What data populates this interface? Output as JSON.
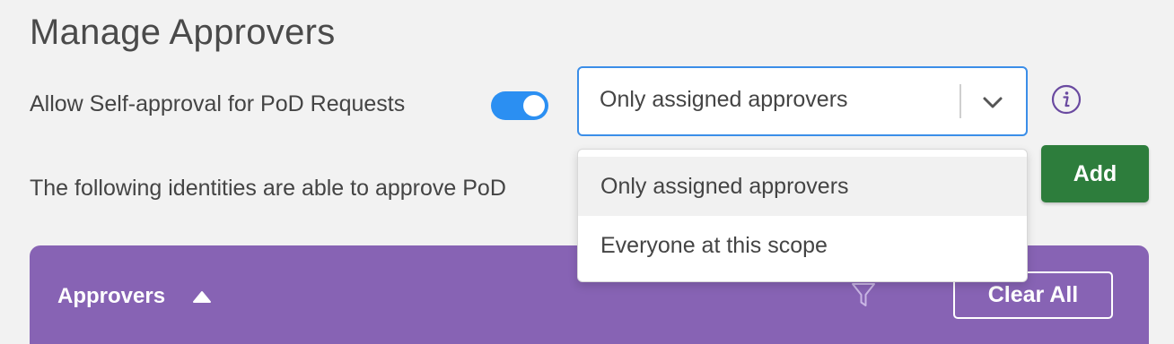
{
  "page": {
    "title": "Manage Approvers"
  },
  "self_approval": {
    "label": "Allow Self-approval for PoD Requests",
    "enabled": true,
    "select_value": "Only assigned approvers",
    "options": [
      "Only assigned approvers",
      "Everyone at this scope"
    ],
    "selected_option": "Only assigned approvers"
  },
  "identities": {
    "description": "The following identities are able to approve PoD"
  },
  "actions": {
    "add_label": "Add"
  },
  "approvers_panel": {
    "title": "Approvers",
    "clear_all_label": "Clear All"
  },
  "colors": {
    "toggle_on": "#2b8ff2",
    "select_focus_border": "#3b8ee8",
    "add_button": "#2d7d3c",
    "panel_header": "#8763b4",
    "info_icon": "#6a4aa0"
  }
}
